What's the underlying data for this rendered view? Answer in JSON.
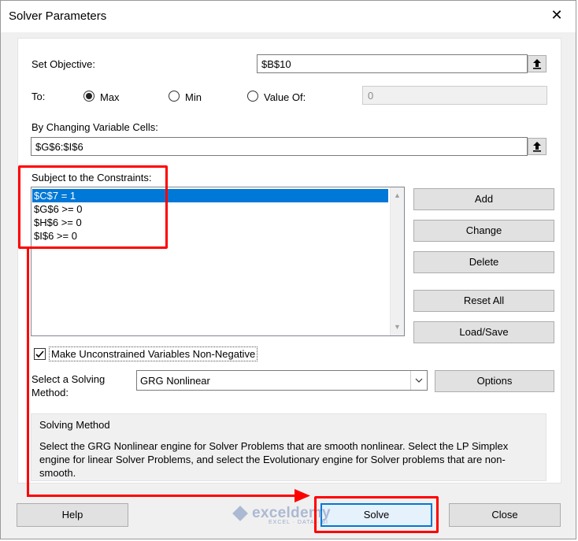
{
  "window": {
    "title": "Solver Parameters",
    "close_glyph": "✕"
  },
  "objective": {
    "label": "Set Objective:",
    "value": "$B$10"
  },
  "to": {
    "label": "To:",
    "options": [
      {
        "label": "Max",
        "selected": true
      },
      {
        "label": "Min",
        "selected": false
      },
      {
        "label": "Value Of:",
        "selected": false
      }
    ],
    "value_of": "0"
  },
  "changing": {
    "label": "By Changing Variable Cells:",
    "value": "$G$6:$I$6"
  },
  "constraints": {
    "label": "Subject to the Constraints:",
    "items": [
      "$C$7 = 1",
      "$G$6 >= 0",
      "$H$6 >= 0",
      "$I$6 >= 0"
    ],
    "selected_index": 0
  },
  "constraint_buttons": {
    "add": "Add",
    "change": "Change",
    "delete": "Delete",
    "reset_all": "Reset All",
    "load_save": "Load/Save"
  },
  "nonneg": {
    "label": "Make Unconstrained Variables Non-Negative",
    "checked": true
  },
  "method": {
    "label_line1": "Select a Solving",
    "label_line2": "Method:",
    "value": "GRG Nonlinear",
    "options_button": "Options"
  },
  "info": {
    "title": "Solving Method",
    "text": "Select the GRG Nonlinear engine for Solver Problems that are smooth nonlinear. Select the LP Simplex engine for linear Solver Problems, and select the Evolutionary engine for Solver problems that are non-smooth."
  },
  "footer": {
    "help": "Help",
    "solve": "Solve",
    "close": "Close"
  },
  "watermark": {
    "name": "exceldemy",
    "tagline": "EXCEL · DATA · BI"
  },
  "colors": {
    "highlight": "#0078d7",
    "annotation": "#ff0000",
    "default_button_border": "#0078d7"
  },
  "icons": {
    "range_select": "collapse-dialog-arrow-icon",
    "close": "close-icon",
    "dropdown": "chevron-down-icon"
  }
}
